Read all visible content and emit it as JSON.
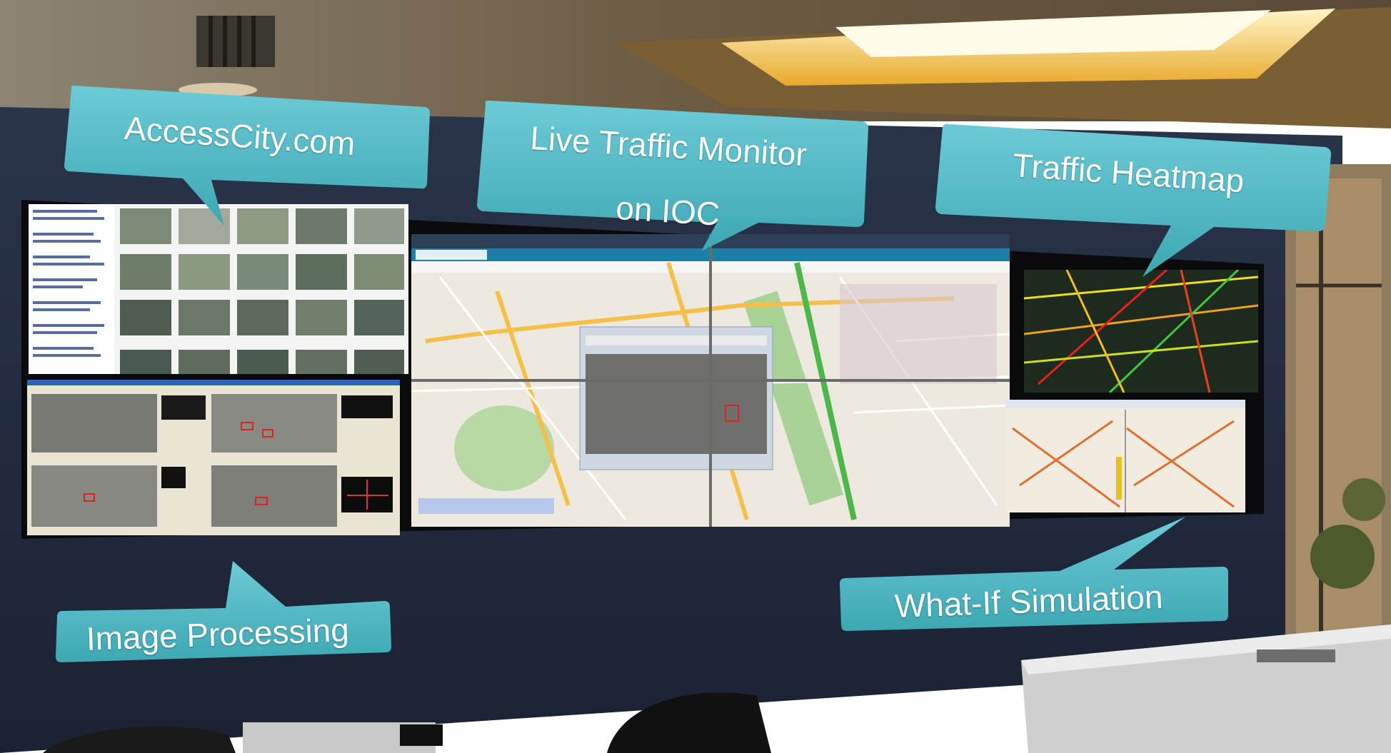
{
  "callouts": {
    "accesscity": "AccessCity.com",
    "live_traffic_line1": "Live Traffic Monitor",
    "live_traffic_line2": "on IOC",
    "heatmap": "Traffic Heatmap",
    "image_processing": "Image Processing",
    "what_if": "What-If Simulation"
  },
  "colors": {
    "callout_fill": "#4fb8c4",
    "callout_dark": "#2f8f9b",
    "wall": "#1f2a3d",
    "ceiling": "#6b5a44",
    "ceiling_light": "#f2c64a",
    "map_bg": "#eee9de",
    "heatmap_bg": "#1e2a1e"
  }
}
